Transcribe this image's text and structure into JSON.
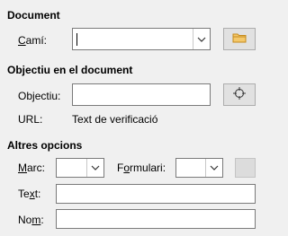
{
  "document": {
    "section_title": "Document",
    "path_label_accel": "C",
    "path_label_rest": "amí:",
    "path_value": ""
  },
  "target": {
    "section_title": "Objectiu en el document",
    "target_label_accel": "j",
    "target_label_pre": "Ob",
    "target_label_rest": "ectiu:",
    "target_value": "",
    "url_label": "URL:",
    "url_value": "Text de verificació"
  },
  "other": {
    "section_title": "Altres opcions",
    "frame_label_accel": "M",
    "frame_label_rest": "arc:",
    "frame_value": "",
    "form_label_pre": "F",
    "form_label_accel": "o",
    "form_label_rest": "rmulari:",
    "form_value": "",
    "text_label_pre": "Te",
    "text_label_accel": "x",
    "text_label_rest": "t:",
    "text_value": "",
    "name_label_pre": "No",
    "name_label_accel": "m",
    "name_label_rest": ":",
    "name_value": ""
  },
  "icons": {
    "open_folder": "folder-icon",
    "target_picker": "crosshair-icon",
    "dropdown": "chevron-down-icon",
    "events": "events-button"
  },
  "colors": {
    "background": "#f0f0f0",
    "field_border": "#7a7a7a",
    "folder_yellow": "#e8b24a"
  }
}
